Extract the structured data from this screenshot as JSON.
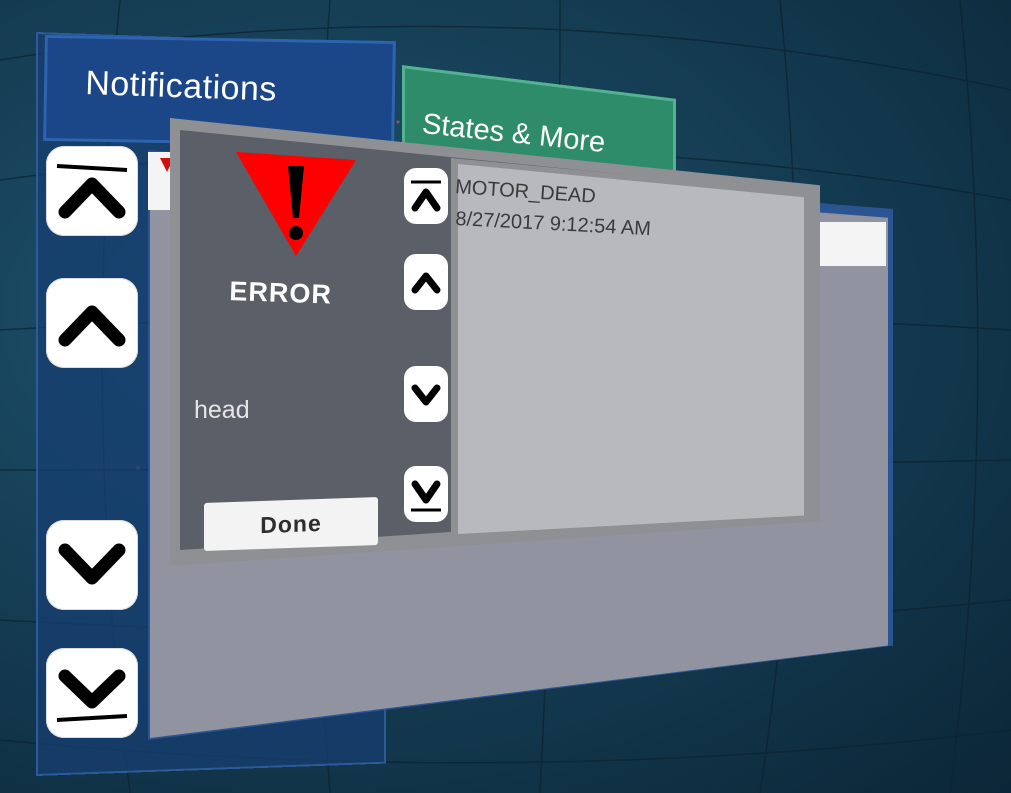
{
  "notifications_panel": {
    "title": "Notifications"
  },
  "states_tab": {
    "label": "States & More"
  },
  "error_dialog": {
    "status_label": "ERROR",
    "component": "head",
    "done_label": "Done",
    "message": {
      "title": "MOTOR_DEAD",
      "timestamp": "8/27/2017 9:12:54 AM"
    }
  },
  "icons": {
    "warning": "warning-triangle-icon",
    "scroll_top": "scroll-to-top-icon",
    "scroll_up": "chevron-up-icon",
    "scroll_down": "chevron-down-icon",
    "scroll_bottom": "scroll-to-bottom-icon"
  },
  "colors": {
    "notifications_tab": "#1b4687",
    "states_tab": "#2f8c6b",
    "dialog_bg": "#5a5f68",
    "content_bg": "#b8b9bd",
    "warning_red": "#ff0000"
  }
}
